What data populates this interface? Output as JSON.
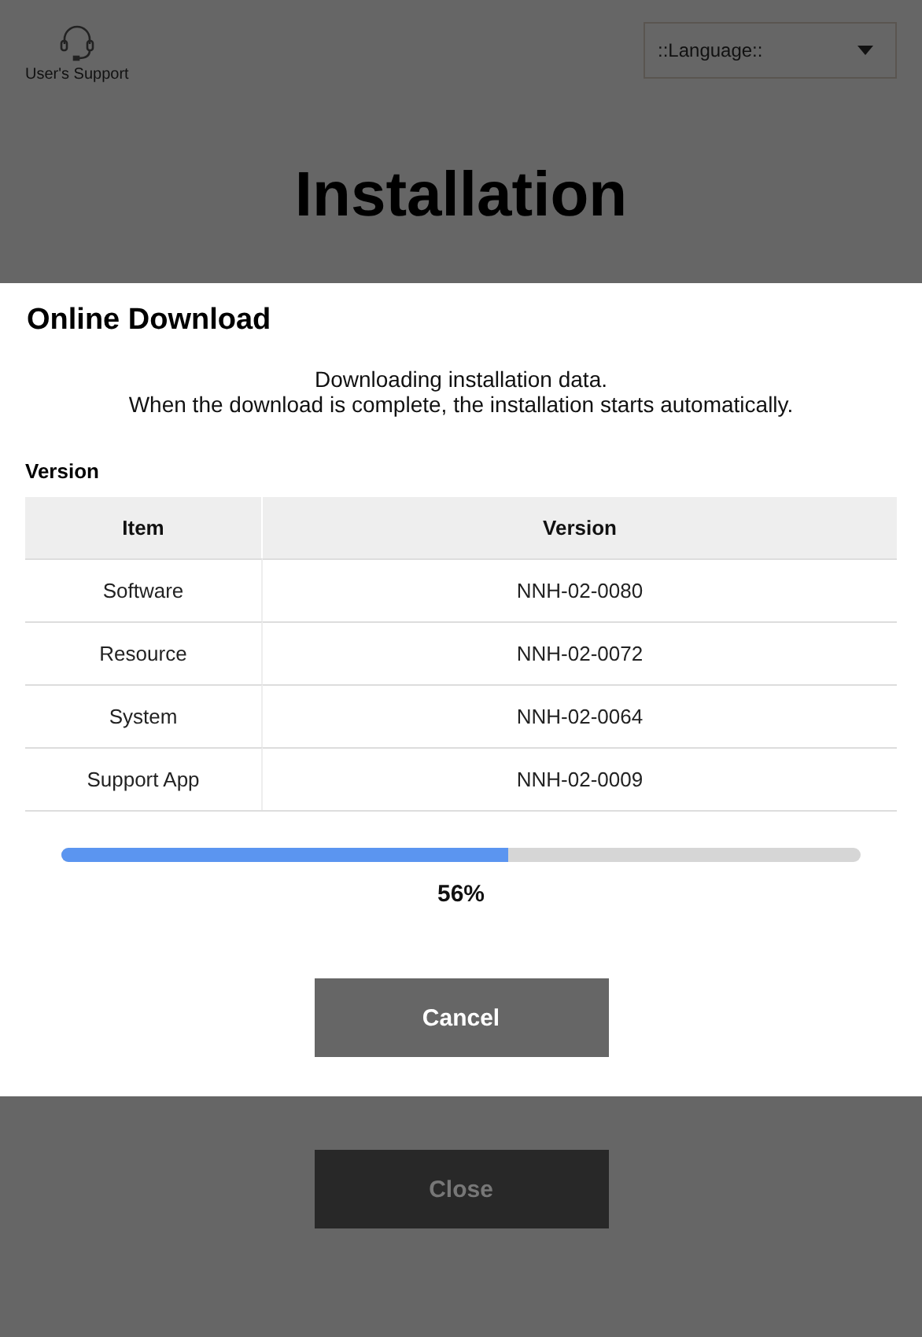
{
  "header": {
    "support_label": "User's Support",
    "language_select": {
      "value": "::Language::"
    }
  },
  "page_title": "Installation",
  "dialog": {
    "title": "Online Download",
    "message_lines": [
      "Downloading installation data.",
      "When the download is complete, the installation starts automatically."
    ],
    "section_label": "Version",
    "table": {
      "columns": [
        "Item",
        "Version"
      ],
      "rows": [
        {
          "item": "Software",
          "version": "NNH-02-0080"
        },
        {
          "item": "Resource",
          "version": "NNH-02-0072"
        },
        {
          "item": "System",
          "version": "NNH-02-0064"
        },
        {
          "item": "Support App",
          "version": "NNH-02-0009"
        }
      ]
    },
    "progress": {
      "level": 0.56,
      "reading": "56%"
    },
    "buttons": [
      {
        "label": "Cancel",
        "disabled": false
      }
    ]
  },
  "footer_buttons": [
    {
      "label": "Close",
      "disabled": true
    }
  ]
}
